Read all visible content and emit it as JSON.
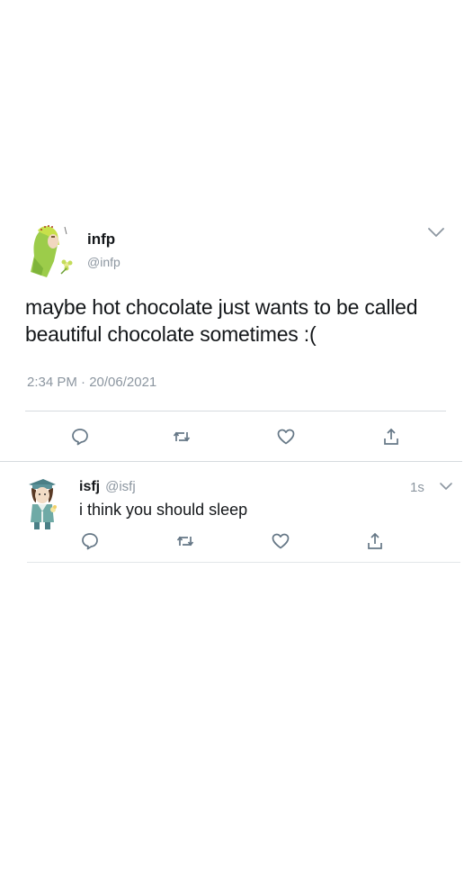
{
  "main_tweet": {
    "author_name": "infp",
    "author_handle": "@infp",
    "text": "maybe hot chocolate just wants to be called beautiful chocolate sometimes :(",
    "timestamp": "2:34 PM · 20/06/2021",
    "avatar_icon": "infp-character-avatar",
    "actions": [
      "reply-icon",
      "retweet-icon",
      "like-icon",
      "share-icon"
    ]
  },
  "reply_tweet": {
    "author_name": "isfj",
    "author_handle": "@isfj",
    "time": "1s",
    "text": "i think you should sleep",
    "avatar_icon": "isfj-character-avatar",
    "actions": [
      "reply-icon",
      "retweet-icon",
      "like-icon",
      "share-icon"
    ]
  },
  "colors": {
    "text": "#14171a",
    "muted": "#8c96a0",
    "divider": "#d6dbdf",
    "icon": "#657786"
  }
}
